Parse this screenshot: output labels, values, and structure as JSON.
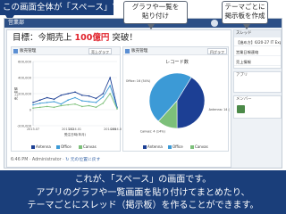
{
  "slide": {
    "headline": "この画面全体が「スペース」です",
    "callout_1": [
      "グラフや一覧を",
      "貼り付け"
    ],
    "callout_2": [
      "テーマごとに",
      "掲示板を作成"
    ],
    "caption": [
      "これが、「スペース」の画面です。",
      "アプリのグラフや一覧画面を貼り付けてまとめたり、",
      "テーマごとにスレッド（掲示板）を作ることができます。"
    ]
  },
  "app": {
    "topbar_title": "営業部",
    "goal_prefix": "目標：今期売上",
    "goal_amount": "100億円",
    "goal_suffix": "突破！",
    "panel_left": {
      "title": "販売管理",
      "button": "売上グラフ"
    },
    "panel_right": {
      "title": "販売管理",
      "button": "円グラフ"
    },
    "footer": {
      "text": "6:46 PM · Administrator · ",
      "link": "↻ 元の位置に戻す"
    },
    "sidebar": {
      "thread_head": "スレッド",
      "threads": [
        "【進め方】6/20-27 IT Expo",
        "営業日報連絡",
        "売上情報"
      ],
      "apps_label": "アプリ",
      "members_label": "メンバー"
    }
  },
  "chart_data": [
    {
      "type": "line",
      "title": "",
      "x": [
        "2013.07",
        "2013.08",
        "2013.09",
        "2013.10",
        "2013.11",
        "2013.12",
        "2014.01",
        "2014.02",
        "2014.03",
        "2014.04",
        "2014.05",
        "2014.06",
        "2014.07"
      ],
      "series": [
        {
          "name": "Antenna",
          "values": [
            90000,
            120000,
            150000,
            130000,
            180000,
            200000,
            220000,
            180000,
            170000,
            140000,
            200000,
            400000,
            30000
          ]
        },
        {
          "name": "Office",
          "values": [
            60000,
            80000,
            90000,
            100000,
            70000,
            120000,
            150000,
            110000,
            100000,
            90000,
            160000,
            300000,
            20000
          ]
        },
        {
          "name": "Canvas",
          "values": [
            20000,
            30000,
            40000,
            30000,
            50000,
            60000,
            70000,
            40000,
            50000,
            30000,
            80000,
            200000,
            10000
          ]
        }
      ],
      "ylim": [
        -200000,
        600000
      ],
      "yticks": [
        -200000,
        0,
        200000,
        400000,
        600000
      ],
      "ytick_labels": [
        "-200,000",
        "0",
        "200,000",
        "400,000",
        "600,000"
      ],
      "xtick_labels": [
        "2013.07",
        "2013.12",
        "2014.01",
        "2014.06",
        "2014.07"
      ],
      "colors": {
        "Antenna": "#1c3f94",
        "Office": "#3c9ad6",
        "Canvas": "#7dc07a"
      },
      "legend": [
        "Antenna",
        "Office",
        "Canvas"
      ],
      "xlabel": "受注日時(年月)",
      "ylabel": "売上金額"
    },
    {
      "type": "pie",
      "title": "レコード数",
      "categories": [
        "Antenna",
        "Canvas",
        "Office"
      ],
      "values": [
        14,
        4,
        16
      ],
      "labels": [
        "Antenna: 14 (41%)",
        "Canvas: 4 (14%)",
        "Office: 16 (54%)"
      ],
      "colors": {
        "Antenna": "#1c3f94",
        "Canvas": "#7dc07a",
        "Office": "#3c9ad6"
      },
      "legend": [
        "Antenna",
        "Office",
        "Canvas"
      ]
    }
  ]
}
